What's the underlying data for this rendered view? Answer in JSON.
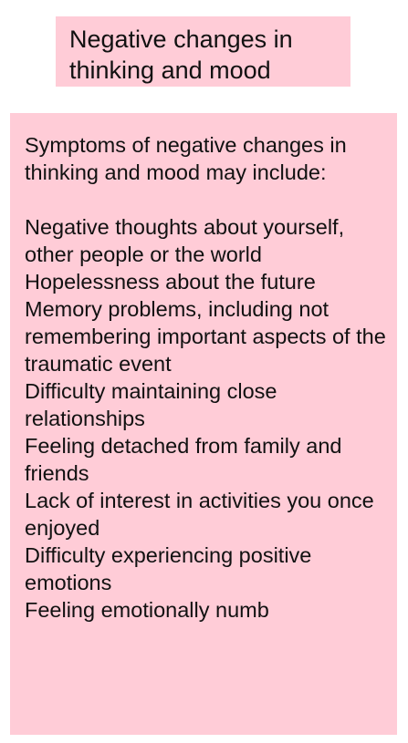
{
  "title": "Negative changes in thinking and mood",
  "intro": "Symptoms of negative changes in thinking and mood may include:",
  "symptoms": [
    "Negative thoughts about yourself, other people or the world",
    "Hopelessness about the future",
    "Memory problems, including not remembering important aspects of the traumatic event",
    "Difficulty maintaining close relationships",
    "Feeling detached from family and friends",
    "Lack of interest in activities you once enjoyed",
    "Difficulty experiencing positive emotions",
    "Feeling emotionally numb"
  ],
  "colors": {
    "box_background": "#ffccd7",
    "text": "#111111"
  }
}
